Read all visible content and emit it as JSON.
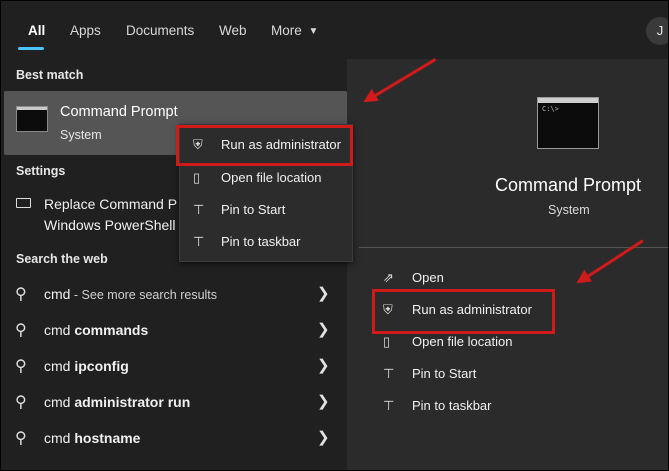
{
  "tabs": [
    {
      "label": "All",
      "active": true
    },
    {
      "label": "Apps"
    },
    {
      "label": "Documents"
    },
    {
      "label": "Web"
    },
    {
      "label": "More"
    }
  ],
  "more_chevron": "▼",
  "avatar_initial": "J",
  "sections": {
    "best_match": "Best match",
    "settings": "Settings",
    "search_web": "Search the web"
  },
  "best_match": {
    "title": "Command Prompt",
    "subtitle": "System",
    "icon": "command-prompt-icon"
  },
  "settings_item": {
    "line1": "Replace Command P",
    "line2": "Windows PowerShell",
    "icon": "settings-list-icon"
  },
  "context_menu": [
    {
      "label": "Run as administrator",
      "icon": "shield-icon"
    },
    {
      "label": "Open file location",
      "icon": "folder-icon"
    },
    {
      "label": "Pin to Start",
      "icon": "pin-icon"
    },
    {
      "label": "Pin to taskbar",
      "icon": "pin-icon"
    }
  ],
  "web_results": [
    {
      "prefix": "cmd",
      "bold": "",
      "sub": " - See more search results"
    },
    {
      "prefix": "cmd ",
      "bold": "commands",
      "sub": ""
    },
    {
      "prefix": "cmd ",
      "bold": "ipconfig",
      "sub": ""
    },
    {
      "prefix": "cmd ",
      "bold": "administrator run",
      "sub": ""
    },
    {
      "prefix": "cmd ",
      "bold": "hostname",
      "sub": ""
    }
  ],
  "preview": {
    "title": "Command Prompt",
    "subtitle": "System",
    "actions": [
      {
        "label": "Open",
        "icon": "open-icon"
      },
      {
        "label": "Run as administrator",
        "icon": "shield-icon"
      },
      {
        "label": "Open file location",
        "icon": "folder-icon"
      },
      {
        "label": "Pin to Start",
        "icon": "pin-icon"
      },
      {
        "label": "Pin to taskbar",
        "icon": "pin-icon"
      }
    ]
  },
  "colors": {
    "accent": "#4cc2ff",
    "annotation_red": "#d11a1a"
  }
}
